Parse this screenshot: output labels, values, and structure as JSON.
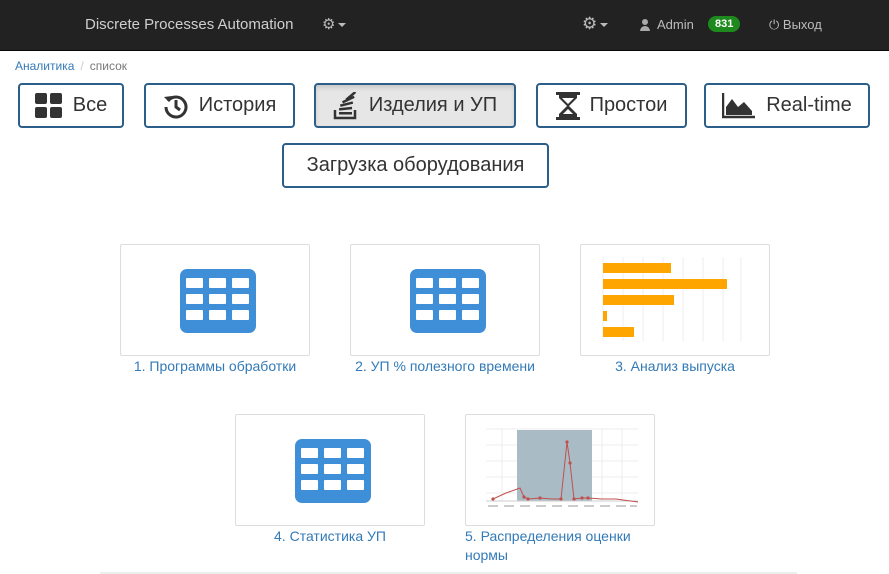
{
  "navbar": {
    "brand": "Discrete Processes Automation",
    "user": "Admin",
    "badge": "831",
    "logout": "Выход"
  },
  "breadcrumb": {
    "root": "Аналитика",
    "current": "список"
  },
  "buttons": {
    "all": "Все",
    "history": "История",
    "products": "Изделия и УП",
    "downtime": "Простои",
    "realtime": "Real-time",
    "load": "Загрузка оборудования"
  },
  "tiles": {
    "t1": "1. Программы обработки",
    "t2": "2. УП % полезного времени",
    "t3": "3. Анализ выпуска",
    "t4": "4. Статистика УП",
    "t5": "5. Распределения оценки нормы"
  },
  "colors": {
    "navbar": "#222222",
    "accent_blue": "#3f8fd8",
    "bar_orange": "#ffa500",
    "badge_green": "#1e8a1e",
    "link": "#337ab7"
  }
}
